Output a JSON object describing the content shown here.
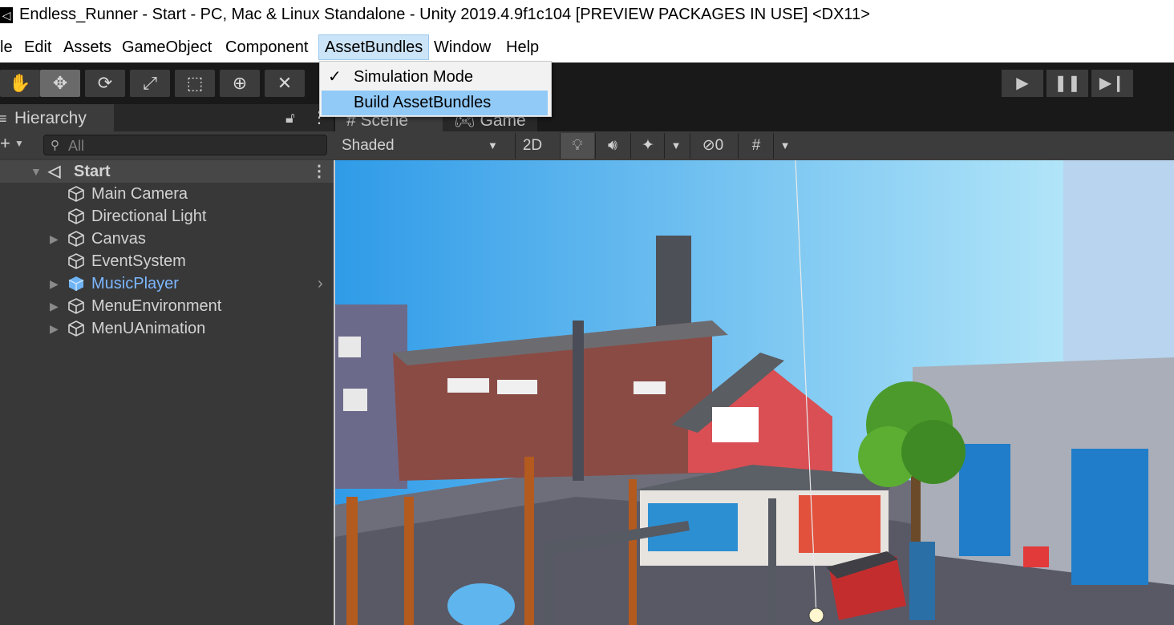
{
  "window": {
    "title": "Endless_Runner - Start - PC, Mac & Linux Standalone - Unity 2019.4.9f1c104 [PREVIEW PACKAGES IN USE] <DX11>"
  },
  "menubar": {
    "items": [
      "le",
      "Edit",
      "Assets",
      "GameObject",
      "Component",
      "AssetBundles",
      "Window",
      "Help"
    ],
    "open_menu": "AssetBundles"
  },
  "dropdown": {
    "items": [
      {
        "label": "Simulation Mode",
        "checked": true
      },
      {
        "label": "Build AssetBundles",
        "highlighted": true
      }
    ]
  },
  "toolbar": {
    "tools": [
      "hand-icon",
      "move-icon",
      "rotate-icon",
      "scale-icon",
      "rect-icon",
      "transform-icon",
      "custom-tool-icon"
    ],
    "active_tool": "move-icon",
    "playback": [
      "play-icon",
      "pause-icon",
      "step-icon"
    ]
  },
  "hierarchy": {
    "tab_label": "Hierarchy",
    "search_placeholder": "All",
    "scene": "Start",
    "items": [
      {
        "label": "Main Camera",
        "expandable": false,
        "selected_color": false
      },
      {
        "label": "Directional Light",
        "expandable": false,
        "selected_color": false
      },
      {
        "label": "Canvas",
        "expandable": true,
        "selected_color": false
      },
      {
        "label": "EventSystem",
        "expandable": false,
        "selected_color": false
      },
      {
        "label": "MusicPlayer",
        "expandable": true,
        "selected_color": true
      },
      {
        "label": "MenuEnvironment",
        "expandable": true,
        "selected_color": false
      },
      {
        "label": "MenUAnimation",
        "expandable": true,
        "selected_color": false
      }
    ],
    "prefab_color": "#7cb7ff"
  },
  "scene_view": {
    "tabs": [
      "Scene",
      "Game"
    ],
    "shading_mode": "Shaded",
    "mode_2d": "2D",
    "hidden_count": "0"
  }
}
